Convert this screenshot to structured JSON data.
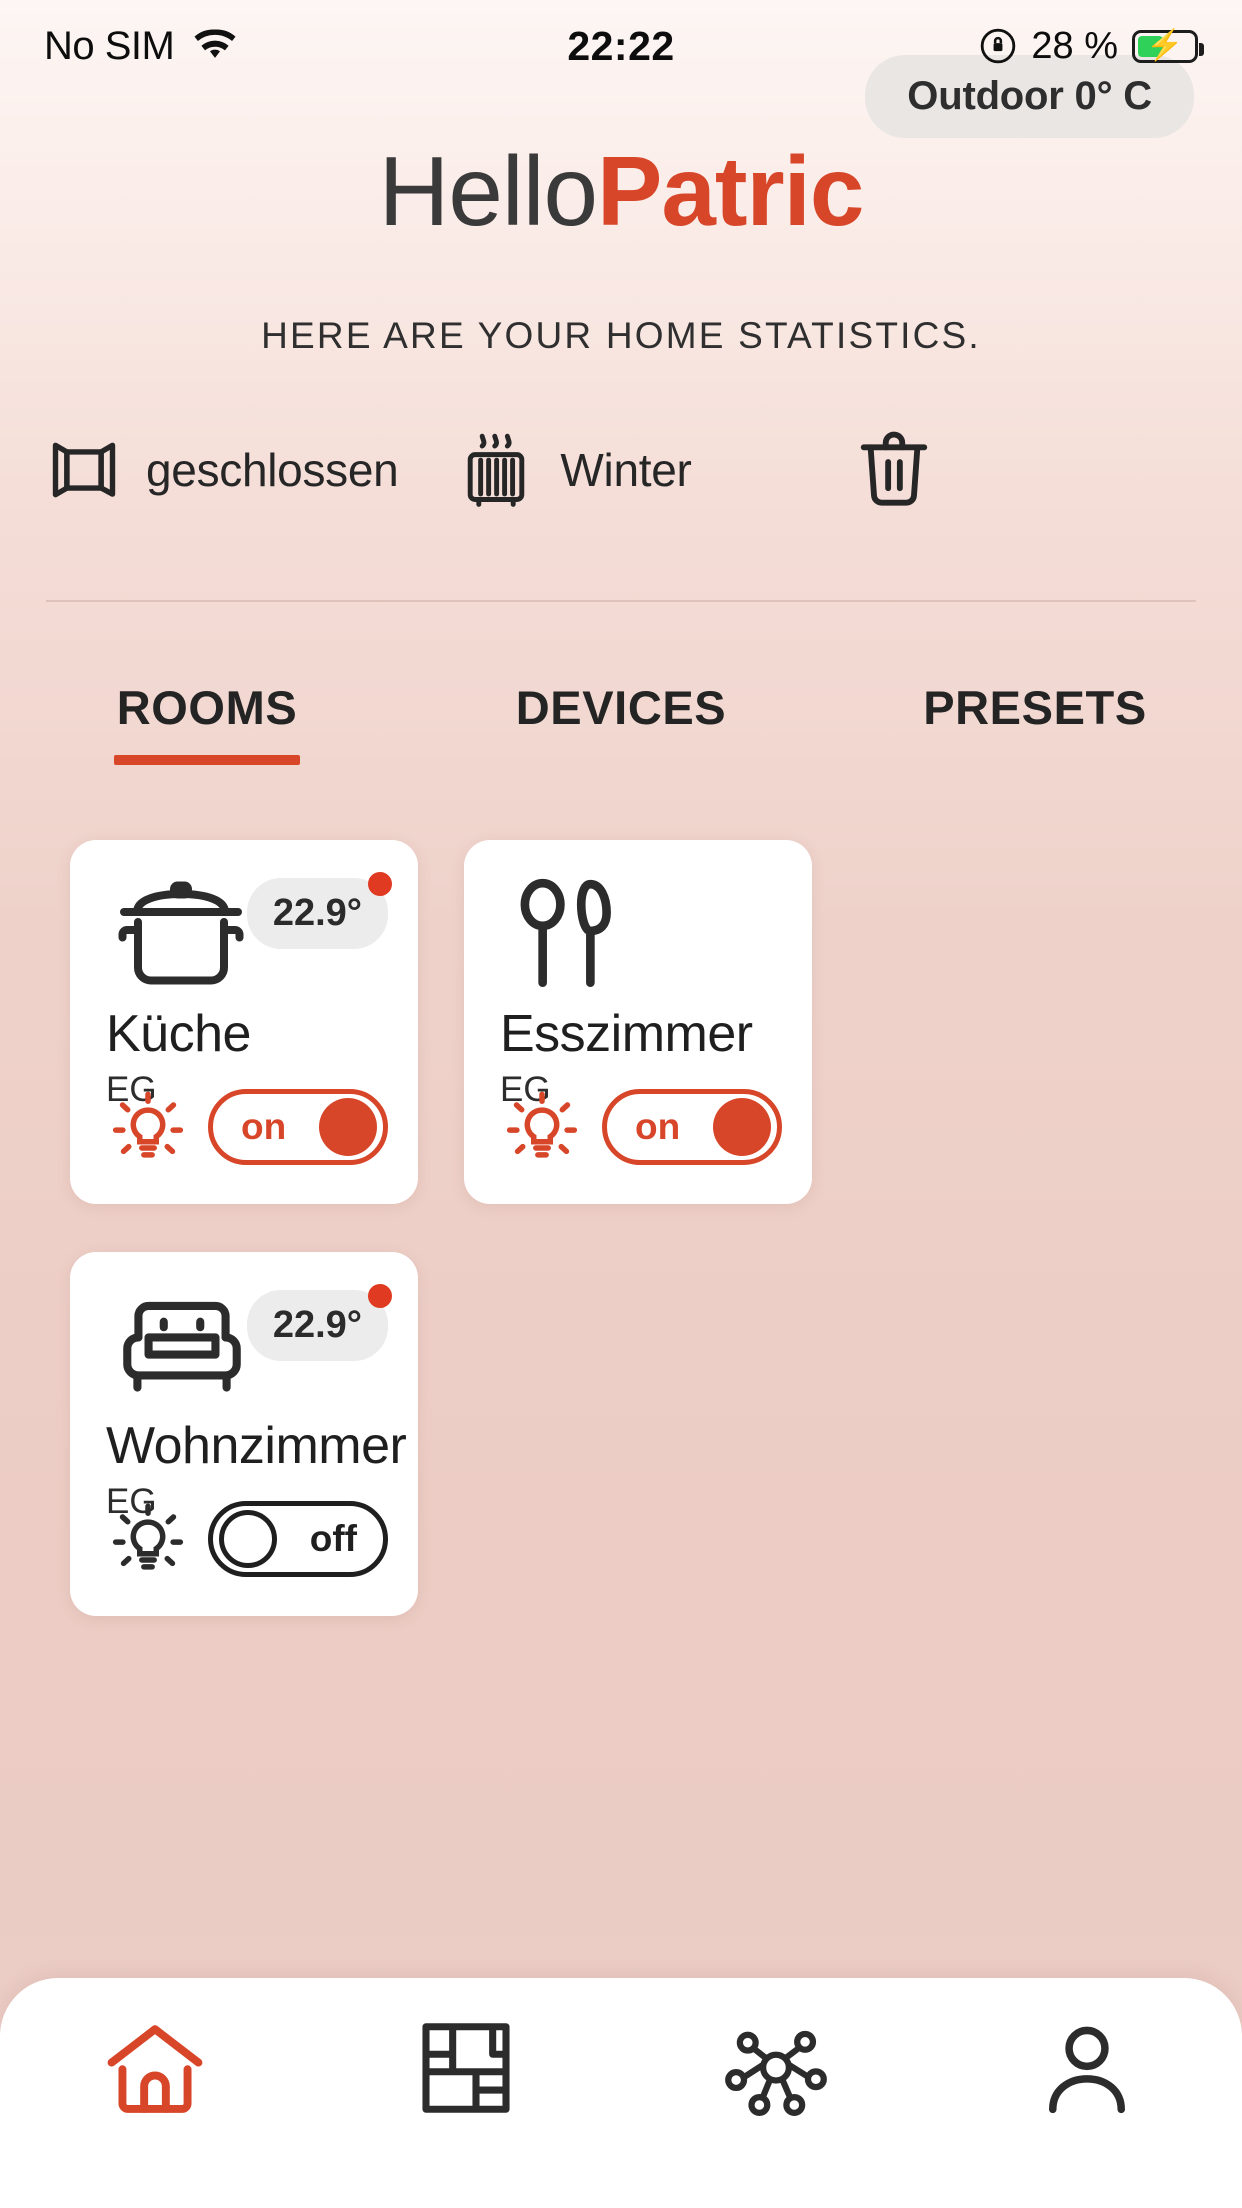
{
  "status_bar": {
    "carrier": "No SIM",
    "wifi_icon": "wifi-icon",
    "time": "22:22",
    "orientation_lock_icon": "rotation-lock-icon",
    "battery_percent": "28 %",
    "battery_icon": "battery-charging-icon"
  },
  "outdoor": {
    "label": "Outdoor 0° C"
  },
  "greeting": {
    "hello": "Hello",
    "name": "Patric"
  },
  "subtitle": {
    "text": "HERE ARE YOUR HOME STATISTICS."
  },
  "statusrow": [
    {
      "icon": "window-icon",
      "label": "geschlossen"
    },
    {
      "icon": "radiator-icon",
      "label": "Winter"
    },
    {
      "icon": "trash-icon",
      "label": ""
    }
  ],
  "tabs": [
    {
      "label": "ROOMS",
      "active": true
    },
    {
      "label": "DEVICES",
      "active": false
    },
    {
      "label": "PRESETS",
      "active": false
    }
  ],
  "rooms": [
    {
      "icon": "cooking-pot-icon",
      "name": "Küche",
      "floor": "EG",
      "temperature": "22.9°",
      "has_alert_dot": true,
      "light_icon": "lightbulb-on-icon",
      "light_state": "on"
    },
    {
      "icon": "cutlery-icon",
      "name": "Esszimmer",
      "floor": "EG",
      "temperature": "",
      "has_alert_dot": false,
      "light_icon": "lightbulb-on-icon",
      "light_state": "on"
    },
    {
      "icon": "armchair-icon",
      "name": "Wohnzimmer",
      "floor": "EG",
      "temperature": "22.9°",
      "has_alert_dot": true,
      "light_icon": "lightbulb-off-icon",
      "light_state": "off"
    }
  ],
  "bottom_nav": [
    {
      "icon": "home-icon",
      "active": true
    },
    {
      "icon": "floorplan-icon",
      "active": false
    },
    {
      "icon": "network-icon",
      "active": false
    },
    {
      "icon": "profile-icon",
      "active": false
    }
  ],
  "colors": {
    "accent": "#d8462a",
    "text_dark": "#1f1f1f",
    "card_bg": "#ffffff",
    "badge_bg": "#ececec",
    "bg_top": "#fdf6f4",
    "bg_bottom": "#eacdc6"
  }
}
